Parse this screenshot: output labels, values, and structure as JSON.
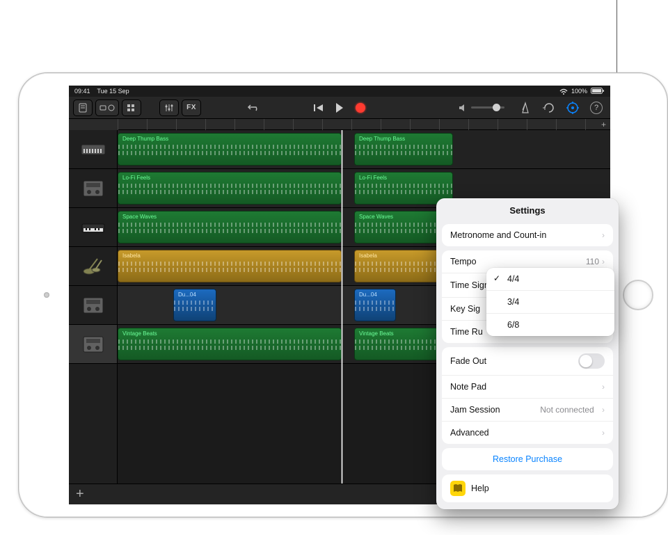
{
  "status": {
    "time": "09:41",
    "date": "Tue 15 Sep",
    "battery": "100%"
  },
  "toolbar": {
    "fx_label": "FX"
  },
  "tracks": [
    {
      "name": "Deep Thump Bass",
      "color": "green",
      "segments": [
        [
          0,
          322
        ],
        [
          340,
          142
        ]
      ]
    },
    {
      "name": "Lo-Fi Feels",
      "color": "green",
      "segments": [
        [
          0,
          322
        ],
        [
          340,
          142
        ]
      ]
    },
    {
      "name": "Space Waves",
      "color": "green",
      "segments": [
        [
          0,
          322
        ],
        [
          340,
          142
        ]
      ]
    },
    {
      "name": "Isabela",
      "color": "yellow",
      "segments": [
        [
          0,
          322
        ],
        [
          340,
          142
        ]
      ]
    },
    {
      "name": "Du...04",
      "color": "blue",
      "segments": [
        [
          80,
          62
        ],
        [
          340,
          60
        ]
      ]
    },
    {
      "name": "Vintage Beats",
      "color": "green",
      "segments": [
        [
          0,
          322
        ],
        [
          340,
          142
        ]
      ]
    }
  ],
  "settings": {
    "title": "Settings",
    "metronome": "Metronome and Count-in",
    "tempo_label": "Tempo",
    "tempo_value": "110",
    "timesig_label": "Time Signature",
    "timesig_value": "4/4",
    "keysig_label": "Key Sig",
    "timeruler_label": "Time Ru",
    "fadeout_label": "Fade Out",
    "notepad_label": "Note Pad",
    "jam_label": "Jam Session",
    "jam_value": "Not connected",
    "advanced_label": "Advanced",
    "restore_label": "Restore Purchase",
    "help_label": "Help",
    "ts_options": [
      "4/4",
      "3/4",
      "6/8"
    ],
    "ts_selected": "4/4"
  }
}
